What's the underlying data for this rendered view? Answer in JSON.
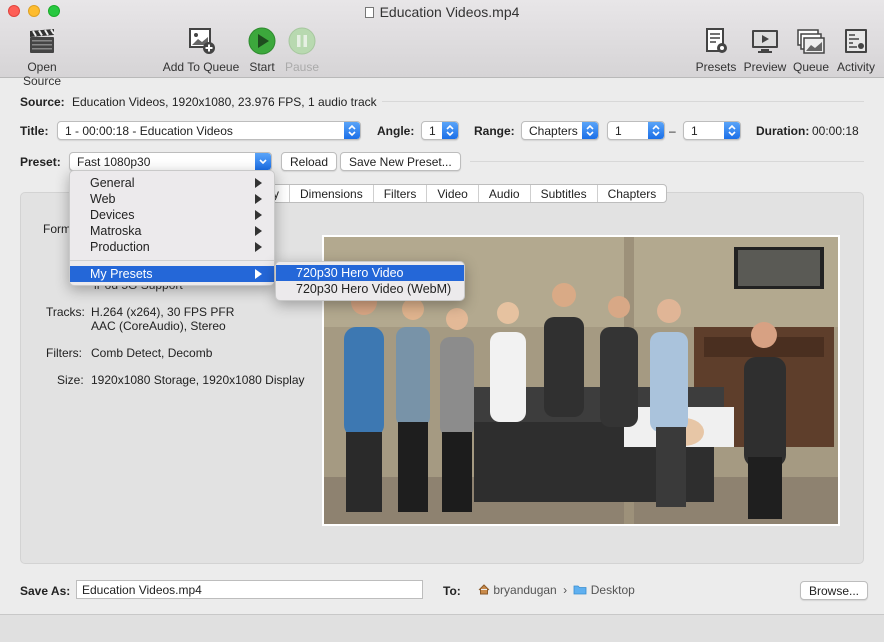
{
  "window": {
    "title": "Education Videos.mp4"
  },
  "toolbar": {
    "open_source": "Open Source",
    "add_to_queue": "Add To Queue",
    "start": "Start",
    "pause": "Pause",
    "presets": "Presets",
    "preview": "Preview",
    "queue": "Queue",
    "activity": "Activity"
  },
  "source": {
    "label": "Source:",
    "value": "Education Videos, 1920x1080, 23.976 FPS, 1 audio track"
  },
  "title_row": {
    "title_label": "Title:",
    "title_value": "1 - 00:00:18 - Education Videos",
    "angle_label": "Angle:",
    "angle_value": "1",
    "range_label": "Range:",
    "range_type": "Chapters",
    "range_start": "1",
    "range_dash": "–",
    "range_end": "1",
    "duration_label": "Duration:",
    "duration_value": "00:00:18"
  },
  "preset_row": {
    "label": "Preset:",
    "value": "Fast 1080p30",
    "reload": "Reload",
    "save_new": "Save New Preset..."
  },
  "tabs": [
    "y",
    "Dimensions",
    "Filters",
    "Video",
    "Audio",
    "Subtitles",
    "Chapters"
  ],
  "summary": {
    "format_label_partial": "Form",
    "ipod_partial": "iPod 5G Support",
    "tracks_label": "Tracks:",
    "tracks_line1": "H.264 (x264), 30 FPS PFR",
    "tracks_line2": "AAC (CoreAudio), Stereo",
    "filters_label": "Filters:",
    "filters_value": "Comb Detect, Decomb",
    "size_label": "Size:",
    "size_value": "1920x1080 Storage, 1920x1080 Display"
  },
  "preset_menu": {
    "items": [
      "General",
      "Web",
      "Devices",
      "Matroska",
      "Production"
    ],
    "my_presets": "My Presets",
    "submenu": [
      "720p30 Hero Video",
      "720p30 Hero Video (WebM)"
    ]
  },
  "save": {
    "label": "Save As:",
    "filename": "Education Videos.mp4",
    "to_label": "To:",
    "path_user": "bryandugan",
    "path_sep": "›",
    "path_folder": "Desktop",
    "browse": "Browse..."
  },
  "colors": {
    "accent": "#2467d8",
    "start_green": "#3ca83c"
  }
}
